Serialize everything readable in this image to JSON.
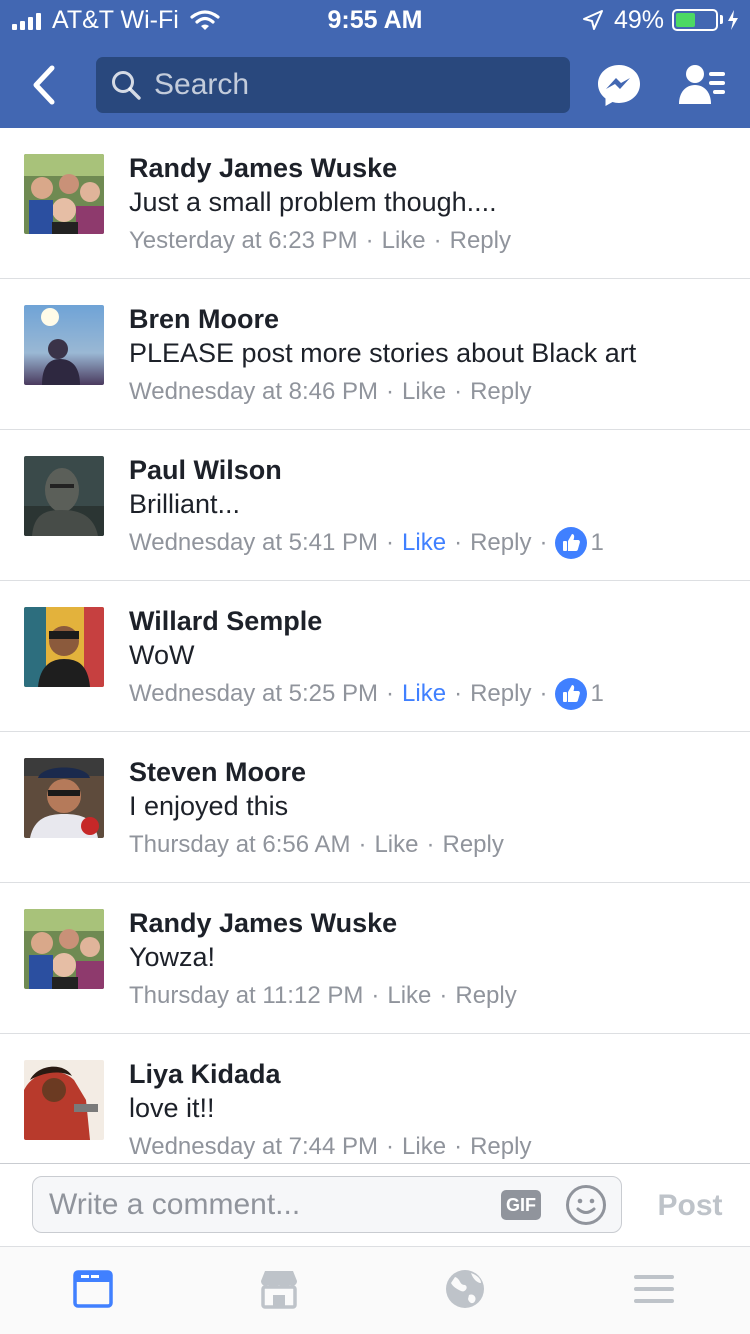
{
  "status_bar": {
    "carrier": "AT&T Wi-Fi",
    "time": "9:55 AM",
    "battery": "49%",
    "battery_level": 0.49,
    "signal_bars": 4
  },
  "nav": {
    "back_icon": "chevron-left-icon",
    "search_placeholder": "Search",
    "messenger_icon": "messenger-icon",
    "friends_icon": "friend-requests-icon"
  },
  "comments": [
    {
      "author": "Randy James Wuske",
      "text": "Just a small problem though....",
      "time": "Yesterday at 6:23 PM",
      "like": "Like",
      "reply": "Reply",
      "liked": false,
      "reactions": ""
    },
    {
      "author": "Bren Moore",
      "text": "PLEASE post more stories about Black art",
      "time": "Wednesday at 8:46 PM",
      "like": "Like",
      "reply": "Reply",
      "liked": false,
      "reactions": ""
    },
    {
      "author": "Paul Wilson",
      "text": "Brilliant...",
      "time": "Wednesday at 5:41 PM",
      "like": "Like",
      "reply": "Reply",
      "liked": true,
      "reactions": "1"
    },
    {
      "author": "Willard Semple",
      "text": "WoW",
      "time": "Wednesday at 5:25 PM",
      "like": "Like",
      "reply": "Reply",
      "liked": true,
      "reactions": "1"
    },
    {
      "author": "Steven Moore",
      "text": "I enjoyed this",
      "time": "Thursday at 6:56 AM",
      "like": "Like",
      "reply": "Reply",
      "liked": false,
      "reactions": ""
    },
    {
      "author": "Randy James Wuske",
      "text": "Yowza!",
      "time": "Thursday at 11:12 PM",
      "like": "Like",
      "reply": "Reply",
      "liked": false,
      "reactions": ""
    },
    {
      "author": "Liya Kidada",
      "text": "love it!!",
      "time": "Wednesday at 7:44 PM",
      "like": "Like",
      "reply": "Reply",
      "liked": false,
      "reactions": ""
    }
  ],
  "composer": {
    "placeholder": "Write a comment...",
    "gif_label": "GIF",
    "post_label": "Post"
  },
  "tabs": [
    {
      "name": "news-feed",
      "icon": "news-feed-icon",
      "active": true
    },
    {
      "name": "marketplace",
      "icon": "marketplace-icon",
      "active": false
    },
    {
      "name": "notifications",
      "icon": "globe-icon",
      "active": false
    },
    {
      "name": "menu",
      "icon": "menu-icon",
      "active": false
    }
  ],
  "colors": {
    "brand_blue": "#4267b2",
    "search_bg": "#29487d",
    "link_blue": "#4080ff",
    "meta_gray": "#90949c",
    "text_dark": "#1d2129"
  }
}
